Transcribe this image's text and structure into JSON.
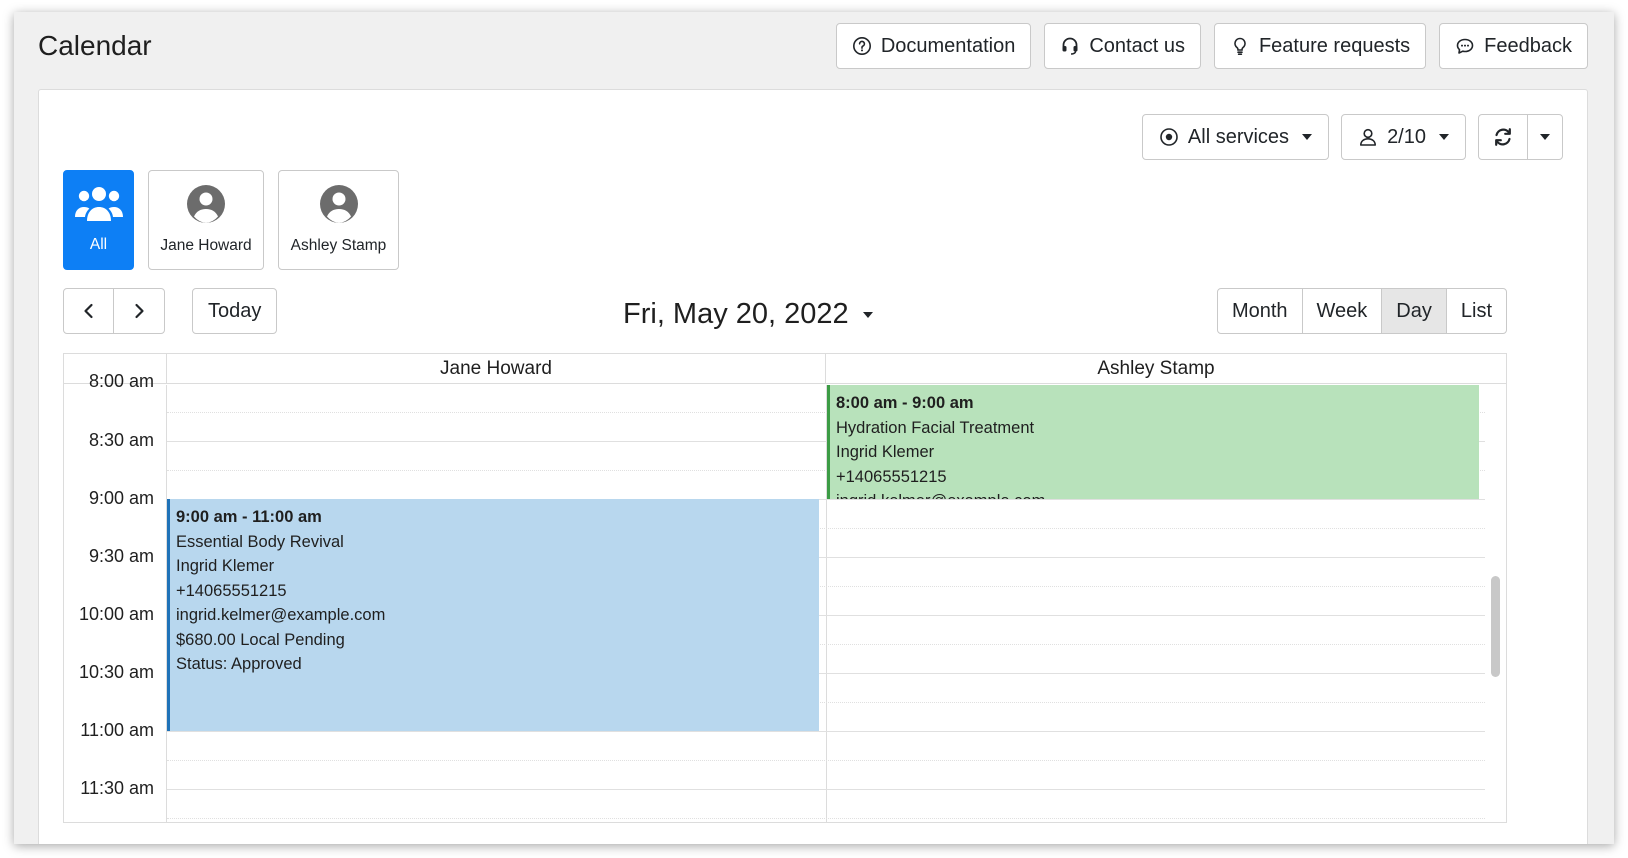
{
  "app": {
    "title": "Calendar"
  },
  "top_actions": [
    {
      "label": "Documentation",
      "icon": "question-circle-icon"
    },
    {
      "label": "Contact us",
      "icon": "headset-icon"
    },
    {
      "label": "Feature requests",
      "icon": "lightbulb-icon"
    },
    {
      "label": "Feedback",
      "icon": "chat-icon"
    }
  ],
  "filters": {
    "services_label": "All services",
    "staff_count": "2/10"
  },
  "staff": [
    {
      "label": "All",
      "icon": "group-icon",
      "active": true
    },
    {
      "label": "Jane Howard",
      "icon": "user-circle-icon",
      "active": false
    },
    {
      "label": "Ashley Stamp",
      "icon": "user-circle-icon",
      "active": false
    }
  ],
  "nav": {
    "today_label": "Today",
    "date_title": "Fri, May 20, 2022"
  },
  "views": [
    {
      "label": "Month",
      "active": false
    },
    {
      "label": "Week",
      "active": false
    },
    {
      "label": "Day",
      "active": true
    },
    {
      "label": "List",
      "active": false
    }
  ],
  "calendar": {
    "columns": [
      "Jane Howard",
      "Ashley Stamp"
    ],
    "time_labels": [
      "8:00 am",
      "8:30 am",
      "9:00 am",
      "9:30 am",
      "10:00 am",
      "10:30 am",
      "11:00 am",
      "11:30 am"
    ],
    "events": [
      {
        "time": "8:00 am - 9:00 am",
        "service": "Hydration Facial Treatment",
        "client": "Ingrid Klemer",
        "phone": "+14065551215",
        "email": "ingrid.kelmer@example.com",
        "color": "#b8e2bb"
      },
      {
        "time": "9:00 am - 11:00 am",
        "service": "Essential Body Revival",
        "client": "Ingrid Klemer",
        "phone": "+14065551215",
        "email": "ingrid.kelmer@example.com",
        "payment": "$680.00 Local Pending",
        "status": "Status: Approved",
        "color": "#b8d7ee"
      }
    ]
  },
  "colors": {
    "accent": "#0d7ff5",
    "event_green": "#b8e2bb",
    "event_blue": "#b8d7ee"
  }
}
